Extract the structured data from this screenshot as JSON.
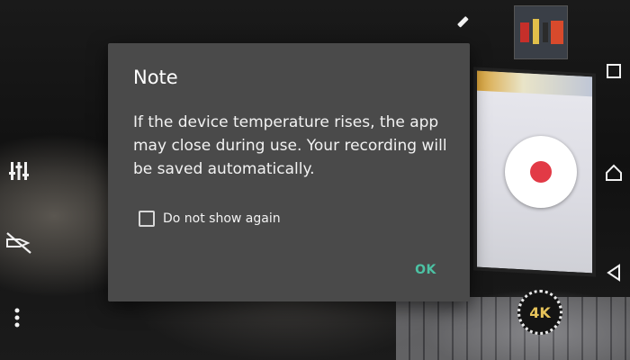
{
  "dialog": {
    "title": "Note",
    "message": "If the device temperature rises, the app may close during use. Your recording will be saved automatically.",
    "checkbox_label": "Do not show again",
    "checkbox_checked": false,
    "ok_label": "OK"
  },
  "camera": {
    "resolution_badge": "4K",
    "record_button_color": "#e23a46",
    "left_controls": [
      "equalizer-settings-icon",
      "flash-off-icon",
      "more-vert-icon"
    ],
    "top_control": "pen-icon"
  },
  "nav_bar": {
    "buttons": [
      "recents-square-icon",
      "home-icon",
      "back-triangle-icon"
    ]
  },
  "colors": {
    "dialog_bg": "#4a4a4a",
    "accent": "#4cc2a4"
  }
}
